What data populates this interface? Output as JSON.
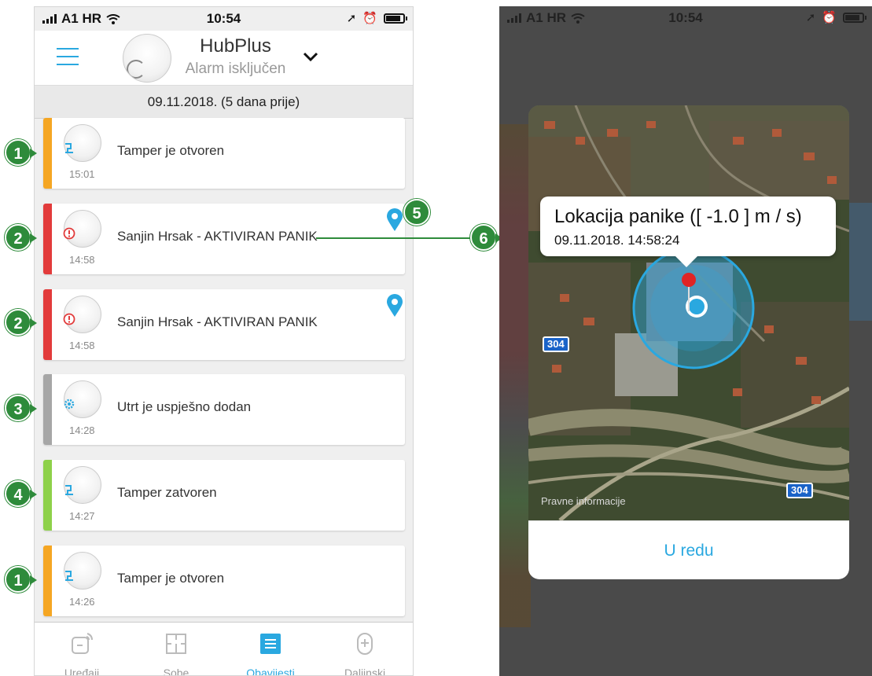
{
  "left_phone": {
    "status": {
      "carrier": "A1 HR",
      "time": "10:54"
    },
    "header": {
      "title": "HubPlus",
      "subtitle": "Alarm isključen"
    },
    "date_header": "09.11.2018. (5 dana prije)",
    "notifications": [
      {
        "message": "Tamper je otvoren",
        "time": "15:01",
        "stripe": "#f5a623",
        "type": "hub",
        "pin": false
      },
      {
        "message": "Sanjin Hrsak - AKTIVIRAN PANIK",
        "time": "14:58",
        "stripe": "#e23b3b",
        "type": "user",
        "pin": true
      },
      {
        "message": "Sanjin Hrsak - AKTIVIRAN PANIK",
        "time": "14:58",
        "stripe": "#e23b3b",
        "type": "user",
        "pin": true
      },
      {
        "message": "Utrt je uspješno dodan",
        "time": "14:28",
        "stripe": "#a6a6a6",
        "type": "device",
        "pin": false
      },
      {
        "message": "Tamper zatvoren",
        "time": "14:27",
        "stripe": "#8ed14a",
        "type": "hub",
        "pin": false
      },
      {
        "message": "Tamper je otvoren",
        "time": "14:26",
        "stripe": "#f5a623",
        "type": "hub",
        "pin": false
      }
    ],
    "tabs": [
      {
        "label": "Uređaji",
        "active": false
      },
      {
        "label": "Sobe",
        "active": false
      },
      {
        "label": "Obavijesti",
        "active": true
      },
      {
        "label": "Daljinski",
        "active": false
      }
    ]
  },
  "callouts": [
    "1",
    "2",
    "2",
    "3",
    "4",
    "1",
    "5",
    "6"
  ],
  "right_phone": {
    "status": {
      "carrier": "A1 HR",
      "time": "10:54"
    },
    "dialog": {
      "tooltip_title": "Lokacija panike ([ -1.0 ] m / s)",
      "tooltip_timestamp": "09.11.2018. 14:58:24",
      "map_legal": "Pravne informacije",
      "road_number": "304",
      "ok_label": "U redu"
    }
  },
  "colors": {
    "accent": "#2aa8e0",
    "callout": "#2e8b3b",
    "alert": "#e23b3b"
  }
}
